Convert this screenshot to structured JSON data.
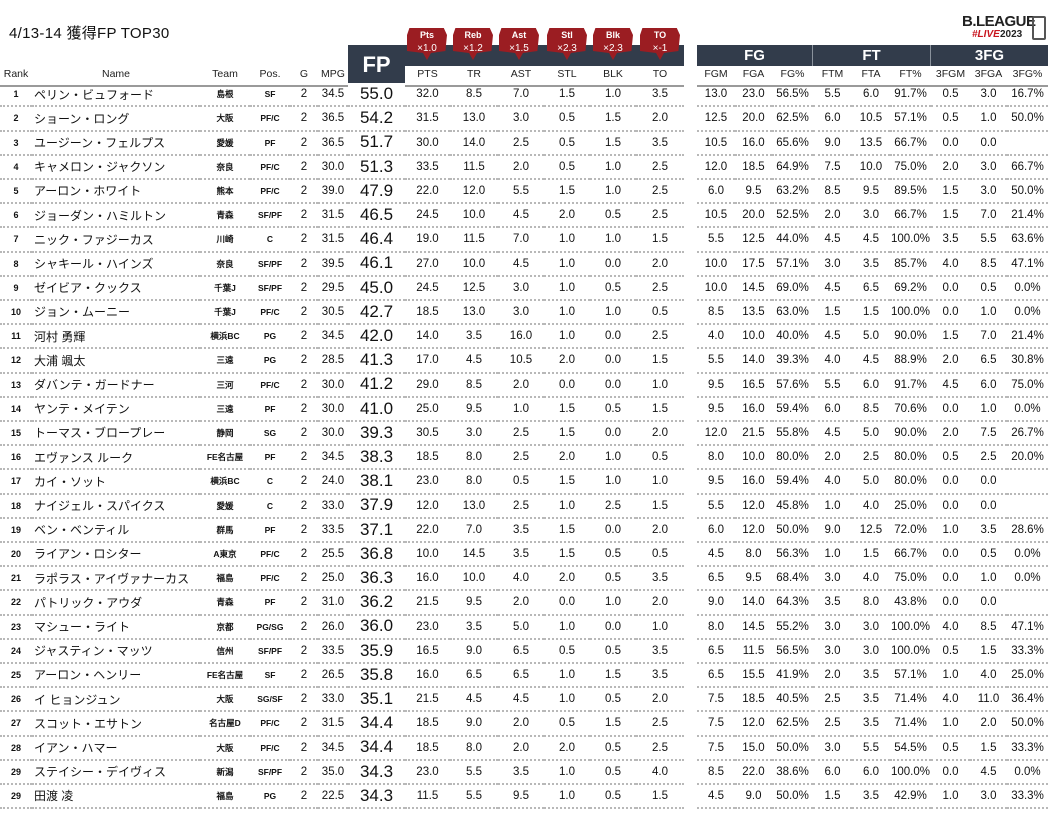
{
  "title": "4/13-14 獲得FP TOP30",
  "logo": {
    "line1": "B.LEAGUE",
    "line2": "#LIVE",
    "line3": "2023"
  },
  "fp_label": "FP",
  "groups": {
    "fg": "FG",
    "ft": "FT",
    "tfg": "3FG"
  },
  "multipliers": [
    {
      "stat": "Pts",
      "factor": "×1.0"
    },
    {
      "stat": "Reb",
      "factor": "×1.2"
    },
    {
      "stat": "Ast",
      "factor": "×1.5"
    },
    {
      "stat": "Stl",
      "factor": "×2.3"
    },
    {
      "stat": "Blk",
      "factor": "×2.3"
    },
    {
      "stat": "TO",
      "factor": "×-1"
    }
  ],
  "columns": [
    "Rank",
    "Name",
    "Team",
    "Pos.",
    "G",
    "MPG",
    "",
    "PTS",
    "TR",
    "AST",
    "STL",
    "BLK",
    "TO",
    "",
    "FGM",
    "FGA",
    "FG%",
    "FTM",
    "FTA",
    "FT%",
    "3FGM",
    "3FGA",
    "3FG%"
  ],
  "rows": [
    [
      "1",
      "ペリン・ビュフォード",
      "島根",
      "SF",
      "2",
      "34.5",
      "55.0",
      "32.0",
      "8.5",
      "7.0",
      "1.5",
      "1.0",
      "3.5",
      "",
      "13.0",
      "23.0",
      "56.5%",
      "5.5",
      "6.0",
      "91.7%",
      "0.5",
      "3.0",
      "16.7%"
    ],
    [
      "2",
      "ショーン・ロング",
      "大阪",
      "PF/C",
      "2",
      "36.5",
      "54.2",
      "31.5",
      "13.0",
      "3.0",
      "0.5",
      "1.5",
      "2.0",
      "",
      "12.5",
      "20.0",
      "62.5%",
      "6.0",
      "10.5",
      "57.1%",
      "0.5",
      "1.0",
      "50.0%"
    ],
    [
      "3",
      "ユージーン・フェルプス",
      "愛媛",
      "PF",
      "2",
      "36.5",
      "51.7",
      "30.0",
      "14.0",
      "2.5",
      "0.5",
      "1.5",
      "3.5",
      "",
      "10.5",
      "16.0",
      "65.6%",
      "9.0",
      "13.5",
      "66.7%",
      "0.0",
      "0.0",
      ""
    ],
    [
      "4",
      "キャメロン・ジャクソン",
      "奈良",
      "PF/C",
      "2",
      "30.0",
      "51.3",
      "33.5",
      "11.5",
      "2.0",
      "0.5",
      "1.0",
      "2.5",
      "",
      "12.0",
      "18.5",
      "64.9%",
      "7.5",
      "10.0",
      "75.0%",
      "2.0",
      "3.0",
      "66.7%"
    ],
    [
      "5",
      "アーロン・ホワイト",
      "熊本",
      "PF/C",
      "2",
      "39.0",
      "47.9",
      "22.0",
      "12.0",
      "5.5",
      "1.5",
      "1.0",
      "2.5",
      "",
      "6.0",
      "9.5",
      "63.2%",
      "8.5",
      "9.5",
      "89.5%",
      "1.5",
      "3.0",
      "50.0%"
    ],
    [
      "6",
      "ジョーダン・ハミルトン",
      "青森",
      "SF/PF",
      "2",
      "31.5",
      "46.5",
      "24.5",
      "10.0",
      "4.5",
      "2.0",
      "0.5",
      "2.5",
      "",
      "10.5",
      "20.0",
      "52.5%",
      "2.0",
      "3.0",
      "66.7%",
      "1.5",
      "7.0",
      "21.4%"
    ],
    [
      "7",
      "ニック・ファジーカス",
      "川崎",
      "C",
      "2",
      "31.5",
      "46.4",
      "19.0",
      "11.5",
      "7.0",
      "1.0",
      "1.0",
      "1.5",
      "",
      "5.5",
      "12.5",
      "44.0%",
      "4.5",
      "4.5",
      "100.0%",
      "3.5",
      "5.5",
      "63.6%"
    ],
    [
      "8",
      "シャキール・ハインズ",
      "奈良",
      "SF/PF",
      "2",
      "39.5",
      "46.1",
      "27.0",
      "10.0",
      "4.5",
      "1.0",
      "0.0",
      "2.0",
      "",
      "10.0",
      "17.5",
      "57.1%",
      "3.0",
      "3.5",
      "85.7%",
      "4.0",
      "8.5",
      "47.1%"
    ],
    [
      "9",
      "ゼイビア・クックス",
      "千葉J",
      "SF/PF",
      "2",
      "29.5",
      "45.0",
      "24.5",
      "12.5",
      "3.0",
      "1.0",
      "0.5",
      "2.5",
      "",
      "10.0",
      "14.5",
      "69.0%",
      "4.5",
      "6.5",
      "69.2%",
      "0.0",
      "0.5",
      "0.0%"
    ],
    [
      "10",
      "ジョン・ムーニー",
      "千葉J",
      "PF/C",
      "2",
      "30.5",
      "42.7",
      "18.5",
      "13.0",
      "3.0",
      "1.0",
      "1.0",
      "0.5",
      "",
      "8.5",
      "13.5",
      "63.0%",
      "1.5",
      "1.5",
      "100.0%",
      "0.0",
      "1.0",
      "0.0%"
    ],
    [
      "11",
      "河村 勇輝",
      "横浜BC",
      "PG",
      "2",
      "34.5",
      "42.0",
      "14.0",
      "3.5",
      "16.0",
      "1.0",
      "0.0",
      "2.5",
      "",
      "4.0",
      "10.0",
      "40.0%",
      "4.5",
      "5.0",
      "90.0%",
      "1.5",
      "7.0",
      "21.4%"
    ],
    [
      "12",
      "大浦 颯太",
      "三遠",
      "PG",
      "2",
      "28.5",
      "41.3",
      "17.0",
      "4.5",
      "10.5",
      "2.0",
      "0.0",
      "1.5",
      "",
      "5.5",
      "14.0",
      "39.3%",
      "4.0",
      "4.5",
      "88.9%",
      "2.0",
      "6.5",
      "30.8%"
    ],
    [
      "13",
      "ダバンテ・ガードナー",
      "三河",
      "PF/C",
      "2",
      "30.0",
      "41.2",
      "29.0",
      "8.5",
      "2.0",
      "0.0",
      "0.0",
      "1.0",
      "",
      "9.5",
      "16.5",
      "57.6%",
      "5.5",
      "6.0",
      "91.7%",
      "4.5",
      "6.0",
      "75.0%"
    ],
    [
      "14",
      "ヤンテ・メイテン",
      "三遠",
      "PF",
      "2",
      "30.0",
      "41.0",
      "25.0",
      "9.5",
      "1.0",
      "1.5",
      "0.5",
      "1.5",
      "",
      "9.5",
      "16.0",
      "59.4%",
      "6.0",
      "8.5",
      "70.6%",
      "0.0",
      "1.0",
      "0.0%"
    ],
    [
      "15",
      "トーマス・ブロープレー",
      "静岡",
      "SG",
      "2",
      "30.0",
      "39.3",
      "30.5",
      "3.0",
      "2.5",
      "1.5",
      "0.0",
      "2.0",
      "",
      "12.0",
      "21.5",
      "55.8%",
      "4.5",
      "5.0",
      "90.0%",
      "2.0",
      "7.5",
      "26.7%"
    ],
    [
      "16",
      "エヴァンス ルーク",
      "FE名古屋",
      "PF",
      "2",
      "34.5",
      "38.3",
      "18.5",
      "8.0",
      "2.5",
      "2.0",
      "1.0",
      "0.5",
      "",
      "8.0",
      "10.0",
      "80.0%",
      "2.0",
      "2.5",
      "80.0%",
      "0.5",
      "2.5",
      "20.0%"
    ],
    [
      "17",
      "カイ・ソット",
      "横浜BC",
      "C",
      "2",
      "24.0",
      "38.1",
      "23.0",
      "8.0",
      "0.5",
      "1.5",
      "1.0",
      "1.0",
      "",
      "9.5",
      "16.0",
      "59.4%",
      "4.0",
      "5.0",
      "80.0%",
      "0.0",
      "0.0",
      ""
    ],
    [
      "18",
      "ナイジェル・スパイクス",
      "愛媛",
      "C",
      "2",
      "33.0",
      "37.9",
      "12.0",
      "13.0",
      "2.5",
      "1.0",
      "2.5",
      "1.5",
      "",
      "5.5",
      "12.0",
      "45.8%",
      "1.0",
      "4.0",
      "25.0%",
      "0.0",
      "0.0",
      ""
    ],
    [
      "19",
      "ベン・ベンティル",
      "群馬",
      "PF",
      "2",
      "33.5",
      "37.1",
      "22.0",
      "7.0",
      "3.5",
      "1.5",
      "0.0",
      "2.0",
      "",
      "6.0",
      "12.0",
      "50.0%",
      "9.0",
      "12.5",
      "72.0%",
      "1.0",
      "3.5",
      "28.6%"
    ],
    [
      "20",
      "ライアン・ロシター",
      "A東京",
      "PF/C",
      "2",
      "25.5",
      "36.8",
      "10.0",
      "14.5",
      "3.5",
      "1.5",
      "0.5",
      "0.5",
      "",
      "4.5",
      "8.0",
      "56.3%",
      "1.0",
      "1.5",
      "66.7%",
      "0.0",
      "0.5",
      "0.0%"
    ],
    [
      "21",
      "ラポラス・アイヴァナーカス",
      "福島",
      "PF/C",
      "2",
      "25.0",
      "36.3",
      "16.0",
      "10.0",
      "4.0",
      "2.0",
      "0.5",
      "3.5",
      "",
      "6.5",
      "9.5",
      "68.4%",
      "3.0",
      "4.0",
      "75.0%",
      "0.0",
      "1.0",
      "0.0%"
    ],
    [
      "22",
      "パトリック・アウダ",
      "青森",
      "PF",
      "2",
      "31.0",
      "36.2",
      "21.5",
      "9.5",
      "2.0",
      "0.0",
      "1.0",
      "2.0",
      "",
      "9.0",
      "14.0",
      "64.3%",
      "3.5",
      "8.0",
      "43.8%",
      "0.0",
      "0.0",
      ""
    ],
    [
      "23",
      "マシュー・ライト",
      "京都",
      "PG/SG",
      "2",
      "26.0",
      "36.0",
      "23.0",
      "3.5",
      "5.0",
      "1.0",
      "0.0",
      "1.0",
      "",
      "8.0",
      "14.5",
      "55.2%",
      "3.0",
      "3.0",
      "100.0%",
      "4.0",
      "8.5",
      "47.1%"
    ],
    [
      "24",
      "ジャスティン・マッツ",
      "信州",
      "SF/PF",
      "2",
      "33.5",
      "35.9",
      "16.5",
      "9.0",
      "6.5",
      "0.5",
      "0.5",
      "3.5",
      "",
      "6.5",
      "11.5",
      "56.5%",
      "3.0",
      "3.0",
      "100.0%",
      "0.5",
      "1.5",
      "33.3%"
    ],
    [
      "25",
      "アーロン・ヘンリー",
      "FE名古屋",
      "SF",
      "2",
      "26.5",
      "35.8",
      "16.0",
      "6.5",
      "6.5",
      "1.0",
      "1.5",
      "3.5",
      "",
      "6.5",
      "15.5",
      "41.9%",
      "2.0",
      "3.5",
      "57.1%",
      "1.0",
      "4.0",
      "25.0%"
    ],
    [
      "26",
      "イ ヒョンジュン",
      "大阪",
      "SG/SF",
      "2",
      "33.0",
      "35.1",
      "21.5",
      "4.5",
      "4.5",
      "1.0",
      "0.5",
      "2.0",
      "",
      "7.5",
      "18.5",
      "40.5%",
      "2.5",
      "3.5",
      "71.4%",
      "4.0",
      "11.0",
      "36.4%"
    ],
    [
      "27",
      "スコット・エサトン",
      "名古屋D",
      "PF/C",
      "2",
      "31.5",
      "34.4",
      "18.5",
      "9.0",
      "2.0",
      "0.5",
      "1.5",
      "2.5",
      "",
      "7.5",
      "12.0",
      "62.5%",
      "2.5",
      "3.5",
      "71.4%",
      "1.0",
      "2.0",
      "50.0%"
    ],
    [
      "28",
      "イアン・ハマー",
      "大阪",
      "PF/C",
      "2",
      "34.5",
      "34.4",
      "18.5",
      "8.0",
      "2.0",
      "2.0",
      "0.5",
      "2.5",
      "",
      "7.5",
      "15.0",
      "50.0%",
      "3.0",
      "5.5",
      "54.5%",
      "0.5",
      "1.5",
      "33.3%"
    ],
    [
      "29",
      "ステイシー・デイヴィス",
      "新潟",
      "SF/PF",
      "2",
      "35.0",
      "34.3",
      "23.0",
      "5.5",
      "3.5",
      "1.0",
      "0.5",
      "4.0",
      "",
      "8.5",
      "22.0",
      "38.6%",
      "6.0",
      "6.0",
      "100.0%",
      "0.0",
      "4.5",
      "0.0%"
    ],
    [
      "29",
      "田渡 凌",
      "福島",
      "PG",
      "2",
      "22.5",
      "34.3",
      "11.5",
      "5.5",
      "9.5",
      "1.0",
      "0.5",
      "1.5",
      "",
      "4.5",
      "9.0",
      "50.0%",
      "1.5",
      "3.5",
      "42.9%",
      "1.0",
      "3.0",
      "33.3%"
    ]
  ],
  "colors": {
    "header_dark": "#323c4b",
    "tag_red": "#9b1d22"
  }
}
